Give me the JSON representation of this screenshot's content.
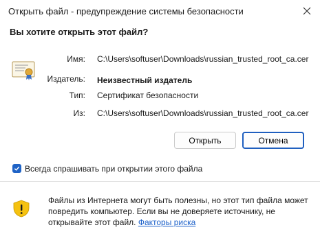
{
  "window": {
    "title": "Открыть файл - предупреждение системы безопасности"
  },
  "heading": "Вы хотите открыть этот файл?",
  "fields": {
    "name": {
      "label": "Имя:",
      "value": "C:\\Users\\softuser\\Downloads\\russian_trusted_root_ca.cer"
    },
    "publisher": {
      "label": "Издатель:",
      "value": "Неизвестный издатель"
    },
    "type": {
      "label": "Тип:",
      "value": "Сертификат безопасности"
    },
    "from": {
      "label": "Из:",
      "value": "C:\\Users\\softuser\\Downloads\\russian_trusted_root_ca.cer"
    }
  },
  "buttons": {
    "open": "Открыть",
    "cancel": "Отмена"
  },
  "checkbox": {
    "label": "Всегда спрашивать при открытии этого файла",
    "checked": true
  },
  "warning": {
    "text": "Файлы из Интернета могут быть полезны, но этот тип файла может повредить компьютер. Если вы не доверяете источнику, не открывайте этот файл.",
    "link": "Факторы риска"
  },
  "icons": {
    "close": "close-icon",
    "certificate": "certificate-icon",
    "checkbox": "checkmark-icon",
    "warning": "shield-warning-icon"
  },
  "colors": {
    "accent": "#1f63c6",
    "link": "#1a5fc9",
    "shield": "#f5c211"
  }
}
